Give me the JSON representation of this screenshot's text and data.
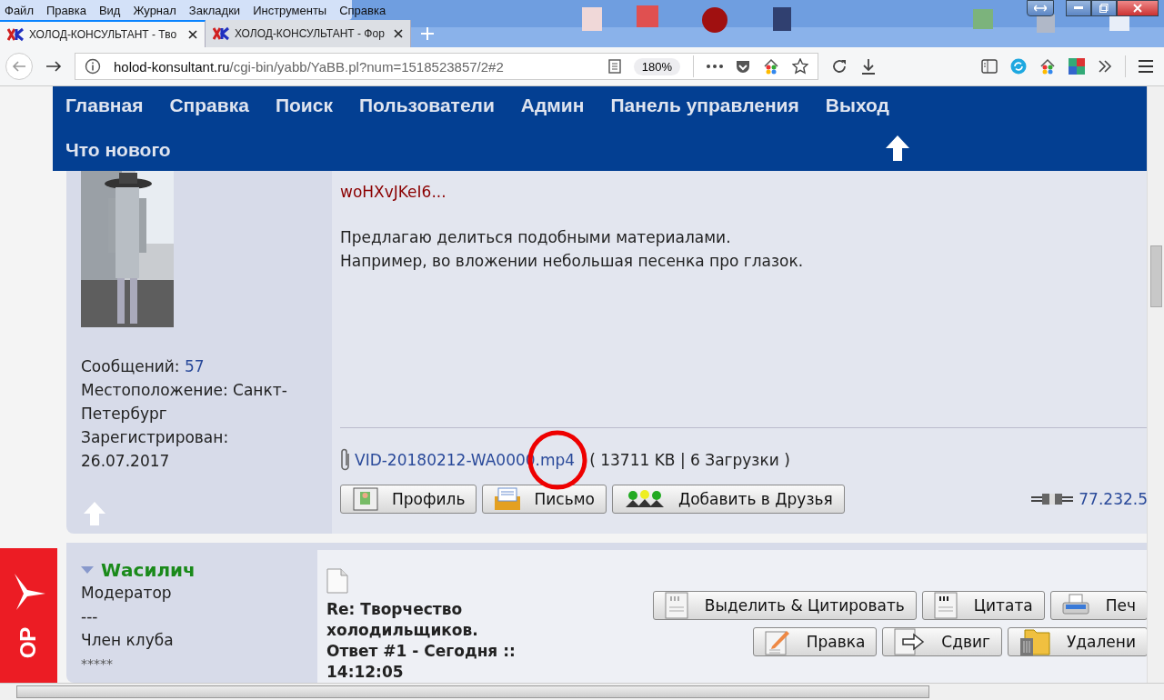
{
  "menu_bar": [
    "Файл",
    "Правка",
    "Вид",
    "Журнал",
    "Закладки",
    "Инструменты",
    "Справка"
  ],
  "tabs": [
    {
      "title": "ХОЛОД-КОНСУЛЬТАНТ - Тво",
      "selected": true
    },
    {
      "title": "ХОЛОД-КОНСУЛЬТАНТ - Фор",
      "selected": false
    }
  ],
  "address_bar": {
    "domain": "holod-konsultant.ru",
    "path": "/cgi-bin/yabb/YaBB.pl?num=1518523857/2#2",
    "zoom": "180%"
  },
  "nav": {
    "items": [
      "Главная",
      "Справка",
      "Поиск",
      "Пользователи",
      "Админ",
      "Панель управления",
      "Выход"
    ],
    "second_row": "Что нового"
  },
  "post": {
    "stats": [
      {
        "label": "Сообщений:",
        "value": "57"
      }
    ],
    "location": "Местоположение: Санкт-Петербург",
    "registered_label": "Зарегистрирован:",
    "registered_date": "26.07.2017",
    "link_tail": "woHXvJKeI6...",
    "paragraphs": [
      "Предлагаю делиться подобными материалами.",
      "Например, во вложении  небольшая песенка про глазок."
    ],
    "attachment": {
      "file": "VID-20180212-WA0000.mp4",
      "info": "( 13711 KB | 6 Загрузки )"
    },
    "buttons": [
      {
        "label": "Профиль",
        "kind": "profile"
      },
      {
        "label": "Письмо",
        "kind": "mail"
      },
      {
        "label": "Добавить в Друзья",
        "kind": "friends"
      }
    ],
    "ip": "77.232.5"
  },
  "reply": {
    "author": "Wасилич",
    "rank": "Модератор",
    "separator": "---",
    "group": "Член клуба",
    "stars": "*****",
    "title": "Re: Творчество холодильщиков.",
    "meta": "Ответ #1 - Сегодня :: 14:12:05",
    "button_rows": [
      [
        {
          "label": "Выделить & Цитировать",
          "kind": "quote-select"
        },
        {
          "label": "Цитата",
          "kind": "quote"
        },
        {
          "label": "Печ",
          "kind": "print"
        }
      ],
      [
        {
          "label": "Правка",
          "kind": "edit"
        },
        {
          "label": "Сдвиг",
          "kind": "move"
        },
        {
          "label": "Удалени",
          "kind": "delete"
        }
      ]
    ]
  },
  "side_badge": "OP"
}
